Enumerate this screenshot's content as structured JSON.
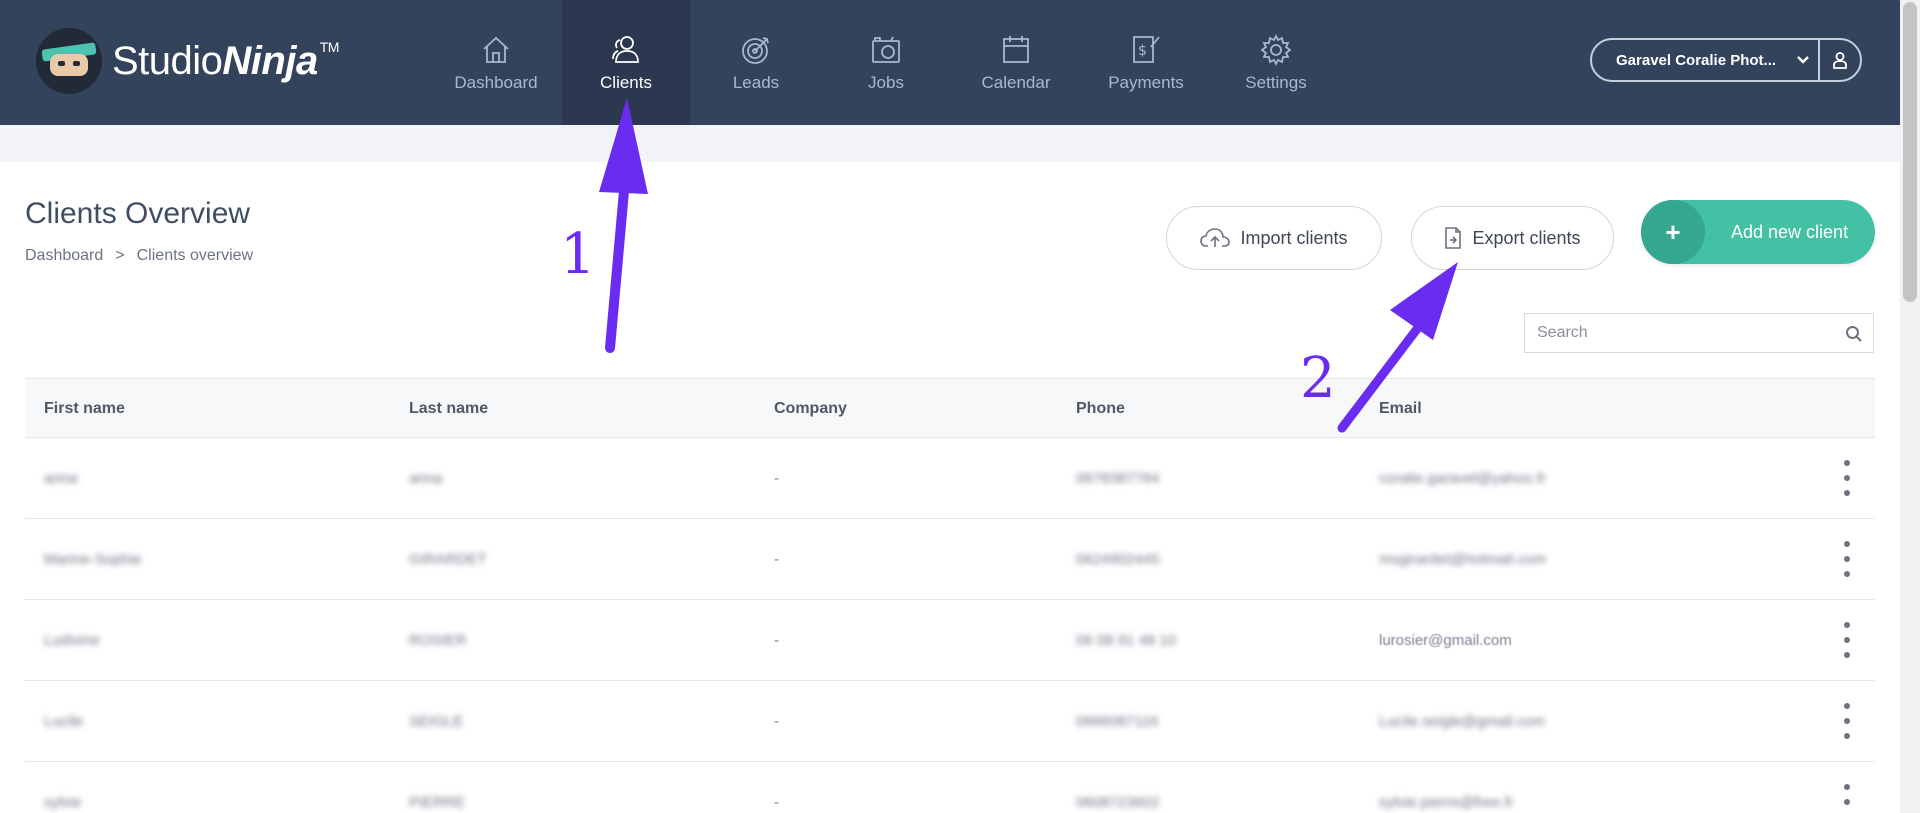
{
  "brand": {
    "studio": "Studio",
    "ninja": "Ninja",
    "tm": "TM"
  },
  "nav": [
    {
      "id": "dashboard",
      "label": "Dashboard",
      "icon": "home-icon",
      "active": false
    },
    {
      "id": "clients",
      "label": "Clients",
      "icon": "users-icon",
      "active": true
    },
    {
      "id": "leads",
      "label": "Leads",
      "icon": "target-icon",
      "active": false
    },
    {
      "id": "jobs",
      "label": "Jobs",
      "icon": "camera-icon",
      "active": false
    },
    {
      "id": "calendar",
      "label": "Calendar",
      "icon": "calendar-icon",
      "active": false
    },
    {
      "id": "payments",
      "label": "Payments",
      "icon": "dollar-icon",
      "active": false
    },
    {
      "id": "settings",
      "label": "Settings",
      "icon": "gear-icon",
      "active": false
    }
  ],
  "account": {
    "name": "Garavel Coralie Phot..."
  },
  "page": {
    "title": "Clients Overview",
    "breadcrumb": {
      "root": "Dashboard",
      "separator": ">",
      "current": "Clients overview"
    }
  },
  "actions": {
    "import_label": "Import clients",
    "export_label": "Export clients",
    "add_label": "Add new client",
    "add_symbol": "+"
  },
  "search": {
    "placeholder": "Search",
    "value": ""
  },
  "table": {
    "columns": [
      "First name",
      "Last name",
      "Company",
      "Phone",
      "Email"
    ],
    "rows": [
      {
        "first": "anna",
        "last": "anna",
        "company": "-",
        "phone": "0678387764",
        "email": "coralie.garavel@yahoo.fr"
      },
      {
        "first": "Marine-Sophie",
        "last": "GIRARDET",
        "company": "-",
        "phone": "0624902445",
        "email": "msgirardet@hotmail.com"
      },
      {
        "first": "Ludivine",
        "last": "ROSIER",
        "company": "-",
        "phone": "06 08 91 48 10",
        "email": "lurosier@gmail.com"
      },
      {
        "first": "Lucile",
        "last": "SEIGLE",
        "company": "-",
        "phone": "0666087116",
        "email": "Lucile.seigle@gmail.com"
      },
      {
        "first": "sylvie",
        "last": "PIERRE",
        "company": "-",
        "phone": "0608723602",
        "email": "sylvie.pierre@free.fr"
      }
    ]
  },
  "annotations": {
    "one": "1",
    "two": "2",
    "color": "#6a2cf0"
  },
  "colors": {
    "nav_bg": "#34435c",
    "nav_active": "#2b3850",
    "accent": "#43c1a4"
  }
}
